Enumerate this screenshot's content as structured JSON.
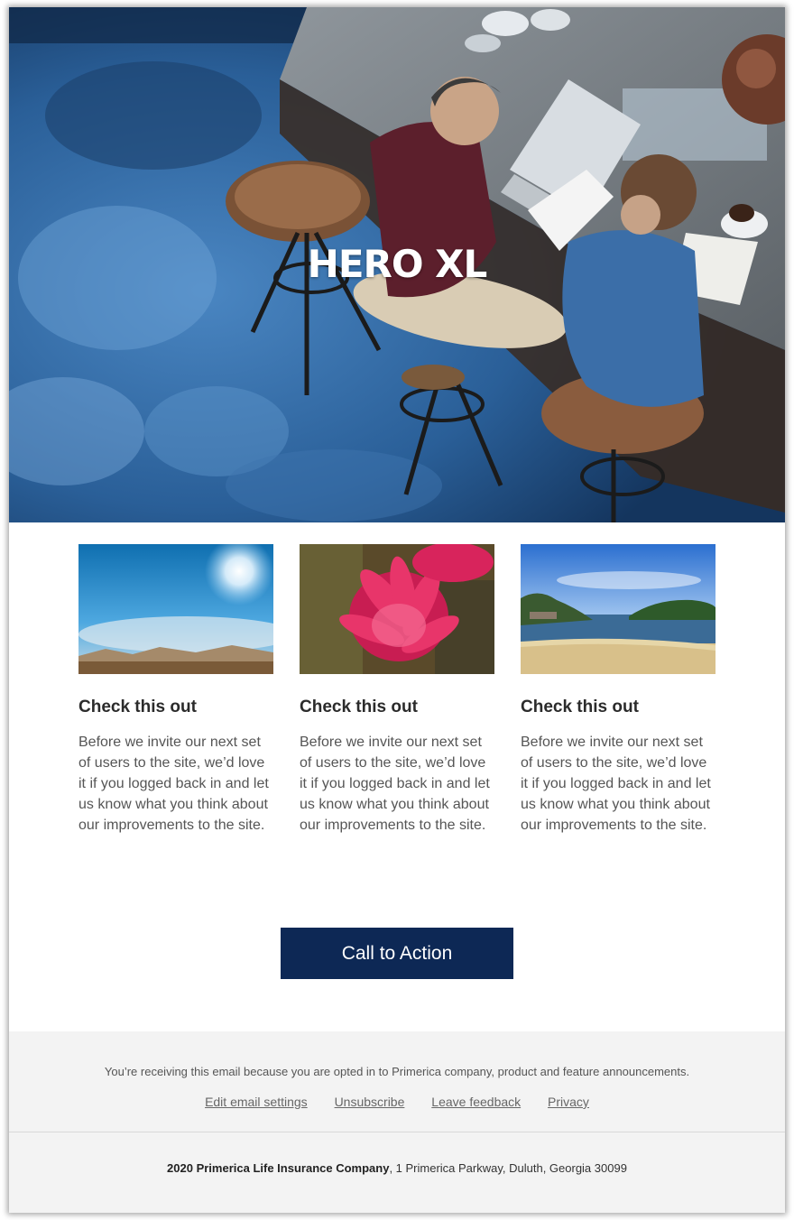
{
  "hero": {
    "title": "HERO XL"
  },
  "cards": [
    {
      "image_icon": "desert-sky-photo",
      "title": "Check this out",
      "body": "Before we invite our next set of users to the site, we’d love it if you logged back in and let us know what you think about our improvements to the site."
    },
    {
      "image_icon": "pink-flower-photo",
      "title": "Check this out",
      "body": "Before we invite our next set of users to the site, we’d love it if you logged back in and let us know what you think about our improvements to the site."
    },
    {
      "image_icon": "beach-cove-photo",
      "title": "Check this out",
      "body": "Before we invite our next set of users to the site, we’d love it if you logged back in and let us know what you think about our improvements to the site."
    }
  ],
  "cta": {
    "label": "Call to Action"
  },
  "footer": {
    "note": "You’re receiving this email because you are opted in to Primerica company, product and feature announcements.",
    "links": [
      {
        "label": "Edit email settings"
      },
      {
        "label": "Unsubscribe"
      },
      {
        "label": "Leave feedback"
      },
      {
        "label": "Privacy"
      }
    ],
    "company": "2020 Primerica Life Insurance Company",
    "address": ", 1 Primerica Parkway, Duluth, Georgia 30099"
  },
  "colors": {
    "cta_background": "#0d2855",
    "footer_background": "#f3f3f3",
    "hero_tint": "#1b4677"
  }
}
